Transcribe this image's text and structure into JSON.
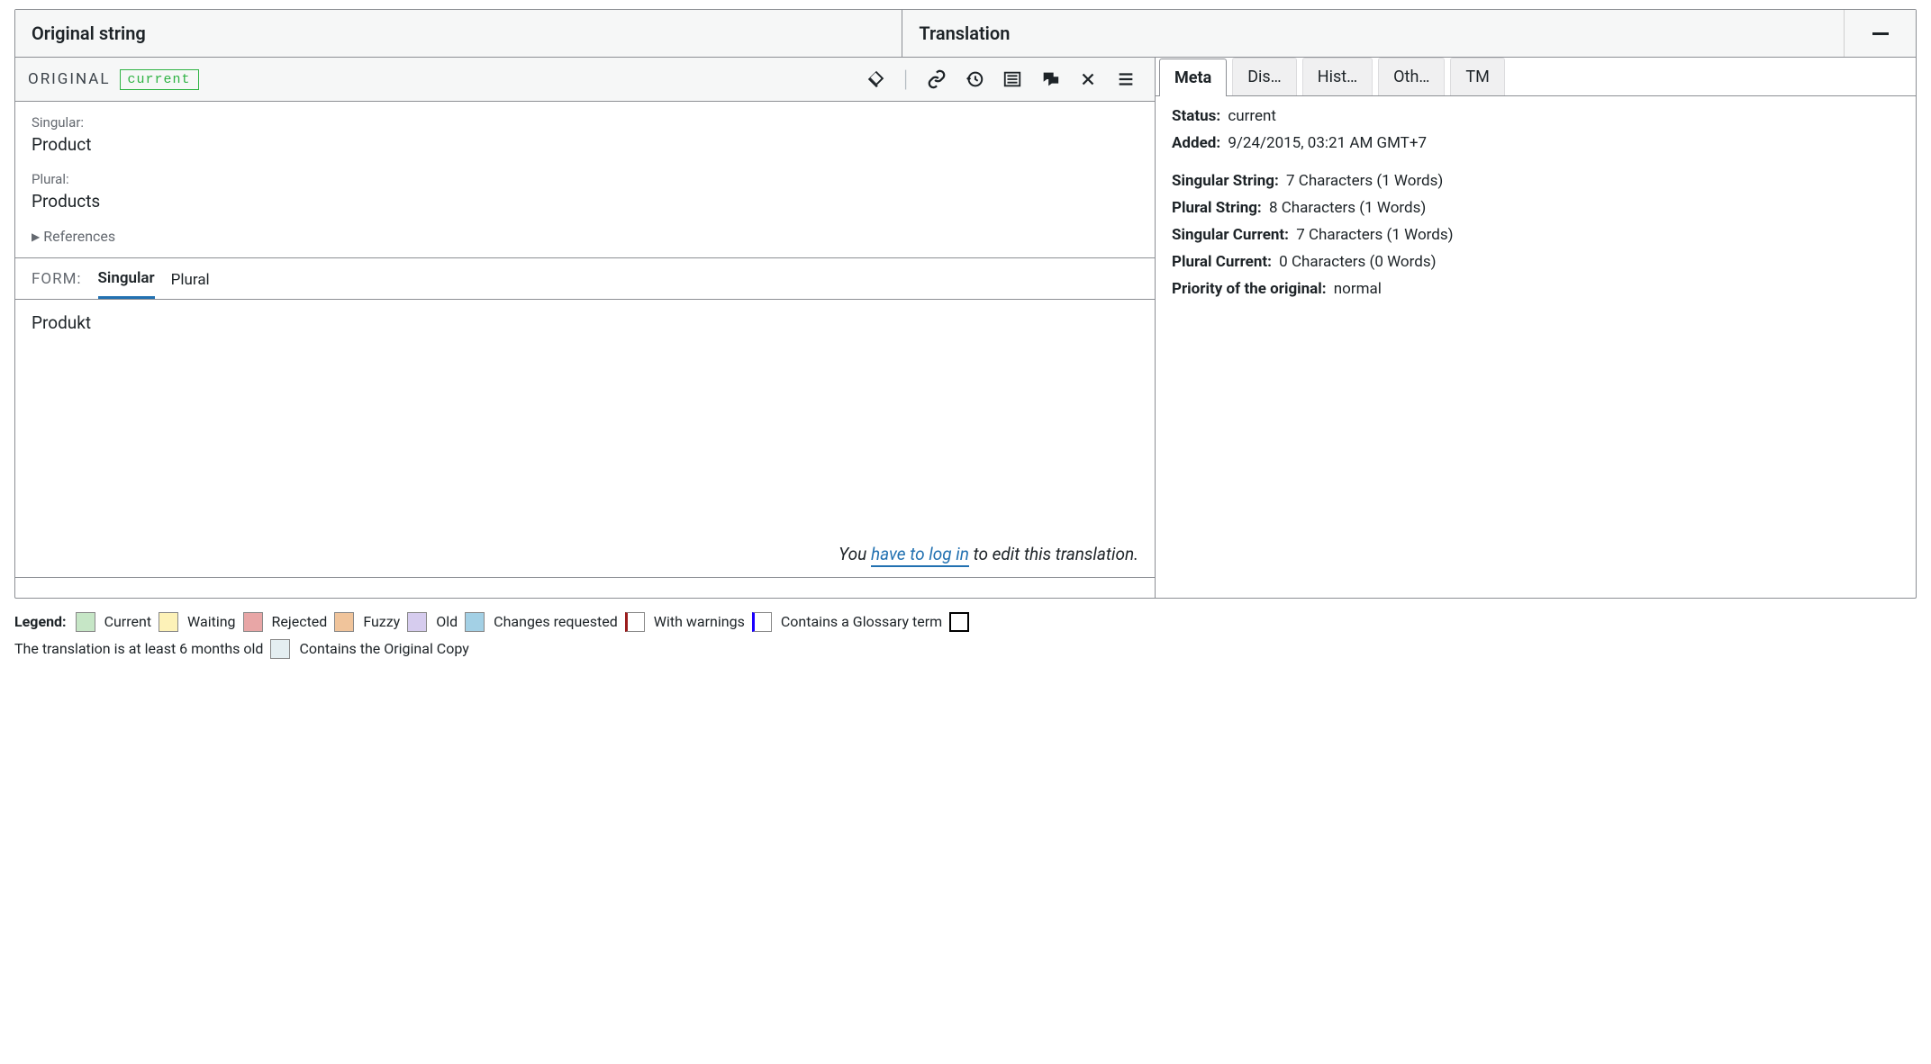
{
  "header": {
    "original": "Original string",
    "translation": "Translation"
  },
  "orig_toolbar": {
    "label": "ORIGINAL",
    "status_chip": "current"
  },
  "original": {
    "singular_label": "Singular:",
    "singular_value": "Product",
    "plural_label": "Plural:",
    "plural_value": "Products",
    "references_label": "References"
  },
  "form": {
    "label": "FORM:",
    "tab_singular": "Singular",
    "tab_plural": "Plural"
  },
  "translation": {
    "singular_value": "Produkt",
    "login_pre": "You ",
    "login_link": "have to log in",
    "login_post": " to edit this translation."
  },
  "right_tabs": {
    "meta": "Meta",
    "discussion": "Dis…",
    "history": "Hist…",
    "others": "Oth…",
    "tm": "TM"
  },
  "meta": {
    "status_k": "Status:",
    "status_v": "current",
    "added_k": "Added:",
    "added_v": "9/24/2015, 03:21 AM GMT+7",
    "sing_str_k": "Singular String:",
    "sing_str_v": "7 Characters (1 Words)",
    "plur_str_k": "Plural String:",
    "plur_str_v": "8 Characters (1 Words)",
    "sing_cur_k": "Singular Current:",
    "sing_cur_v": "7 Characters (1 Words)",
    "plur_cur_k": "Plural Current:",
    "plur_cur_v": "0 Characters (0 Words)",
    "prio_k": "Priority of the original:",
    "prio_v": "normal"
  },
  "legend": {
    "label": "Legend:",
    "current": "Current",
    "waiting": "Waiting",
    "rejected": "Rejected",
    "fuzzy": "Fuzzy",
    "old": "Old",
    "changes": "Changes requested",
    "warnings": "With warnings",
    "glossary": "Contains a Glossary term",
    "six_months": "The translation is at least 6 months old",
    "orig_copy": "Contains the Original Copy",
    "colors": {
      "current": "#c6e6c6",
      "waiting": "#fdf2b8",
      "rejected": "#e8a6a6",
      "fuzzy": "#f0c49b",
      "old": "#d6ccee",
      "changes": "#a3d0e5",
      "warnings_border": "#9b1c1c",
      "glossary_border": "#1b00ff",
      "six_months": "#ffffff",
      "orig_copy": "#e4eef1"
    }
  }
}
